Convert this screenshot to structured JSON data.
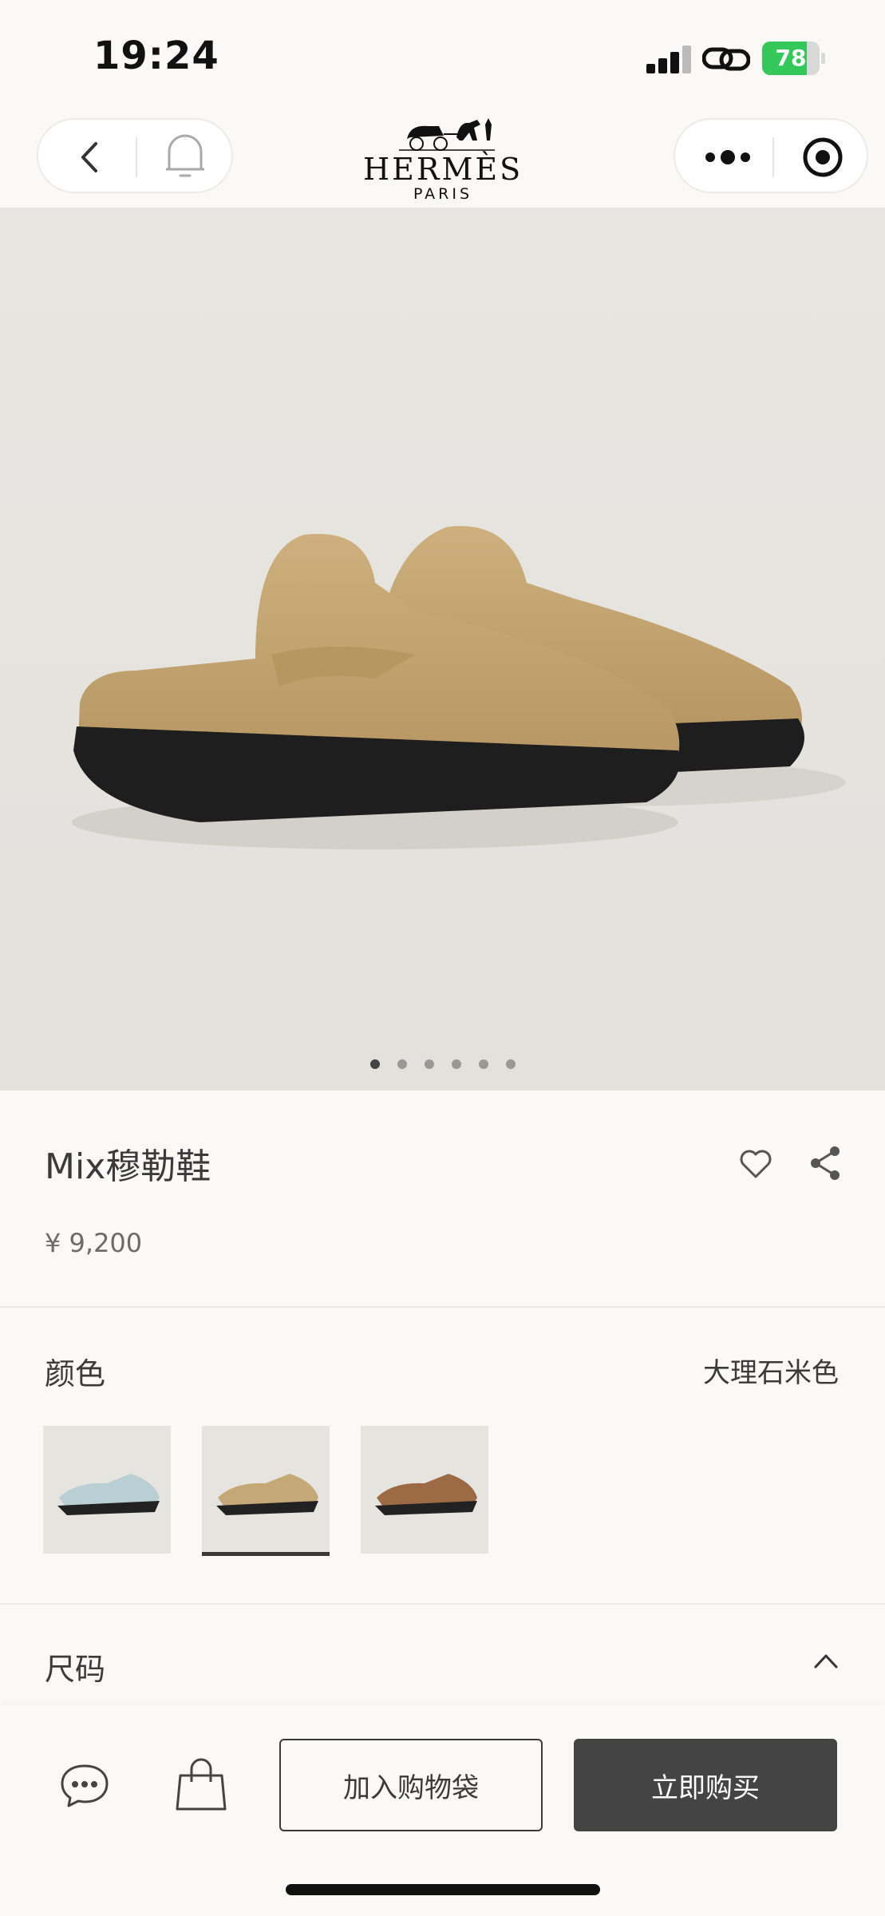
{
  "status_bar": {
    "time": "19:24",
    "battery_level": "78",
    "battery_fraction": 0.78,
    "battery_color": "#34c759"
  },
  "nav": {
    "back_icon": "chevron-left-icon",
    "bell_icon": "bell-icon",
    "more_icon": "more-dots-icon",
    "target_icon": "target-icon"
  },
  "logo": {
    "brand": "HERMÈS",
    "sub": "PARIS"
  },
  "gallery": {
    "image_count": 6,
    "active_index": 0
  },
  "product": {
    "title": "Mix穆勒鞋",
    "price": "¥ 9,200",
    "favorite_icon": "heart-icon",
    "share_icon": "share-icon"
  },
  "color": {
    "label": "颜色",
    "selected": "大理石米色",
    "swatches": [
      {
        "name": "light-blue",
        "color": "#b9cfd3"
      },
      {
        "name": "marble-beige",
        "color": "#c4a876"
      },
      {
        "name": "brown",
        "color": "#9c6b45"
      }
    ],
    "selected_index": 1
  },
  "size": {
    "label": "尺码",
    "toggle_icon": "chevron-up-icon"
  },
  "bottom_bar": {
    "chat_icon": "chat-bubble-icon",
    "bag_icon": "shopping-bag-icon",
    "add_to_bag": "加入购物袋",
    "buy_now": "立即购买"
  }
}
